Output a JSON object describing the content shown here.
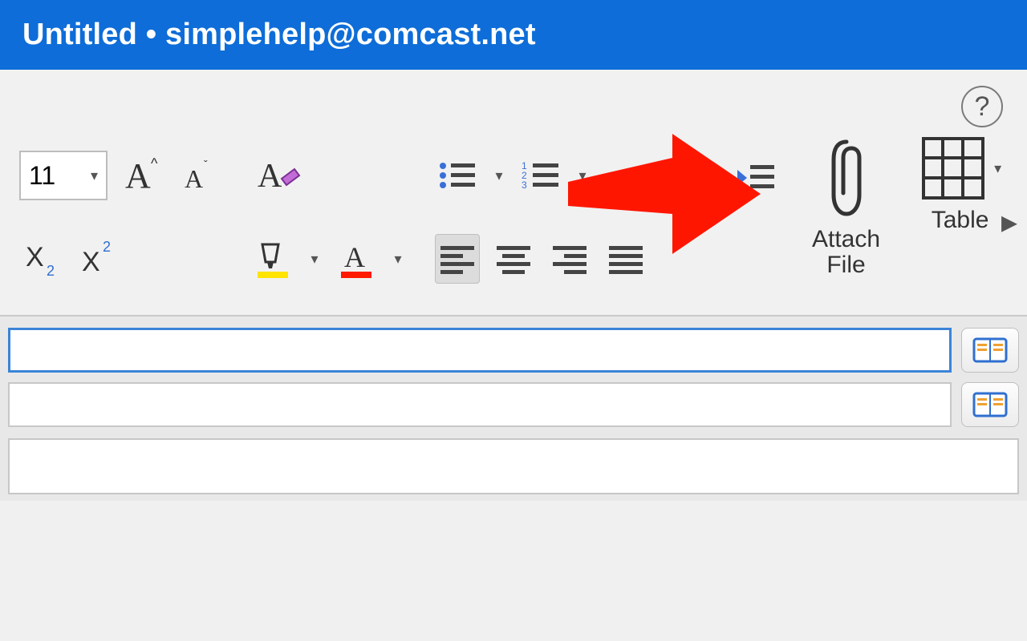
{
  "titlebar": {
    "title": "Untitled • simplehelp@comcast.net"
  },
  "toolbar": {
    "font_size": "11",
    "attach_file_label": "Attach\nFile",
    "table_label": "Table"
  },
  "help": {
    "symbol": "?"
  },
  "colors": {
    "brand_blue": "#0e6dd8",
    "highlight_yellow": "#ffe400",
    "font_color_red": "#ff1a00",
    "list_blue": "#3a6fd8",
    "annotation_red": "#ff1600"
  }
}
